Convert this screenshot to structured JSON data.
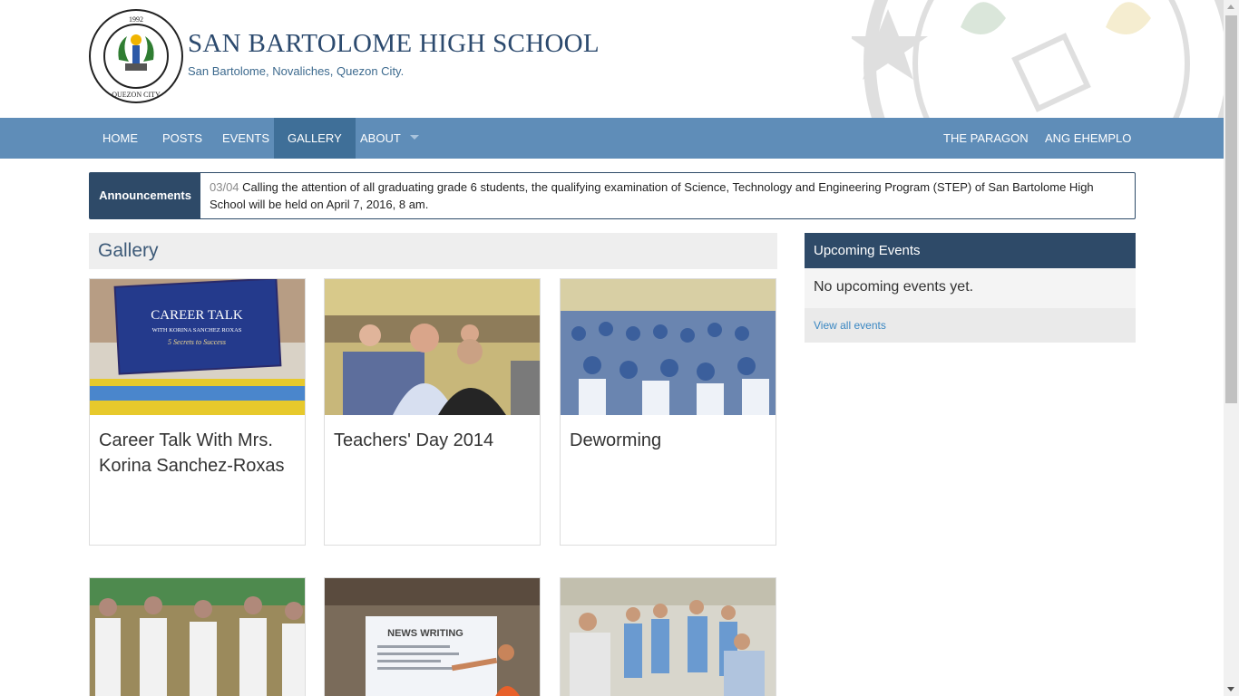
{
  "header": {
    "title": "SAN BARTOLOME HIGH SCHOOL",
    "subtitle": "San Bartolome, Novaliches, Quezon City.",
    "logo_text_top": "SAN BARTOLOME HIGH SCHOOL",
    "logo_text_bottom": "QUEZON CITY",
    "logo_year": "1992"
  },
  "nav": {
    "left": [
      "HOME",
      "POSTS",
      "EVENTS",
      "GALLERY",
      "ABOUT"
    ],
    "right": [
      "THE PARAGON",
      "ANG EHEMPLO"
    ],
    "active": "GALLERY"
  },
  "announcements": {
    "label": "Announcements",
    "date": "03/04",
    "text": "Calling the attention of all graduating grade 6 students, the qualifying examination of Science, Technology and Engineering Program (STEP) of San Bartolome High School will be held on April 7, 2016, 8 am."
  },
  "gallery": {
    "title": "Gallery",
    "albums": [
      {
        "title": "Career Talk With Mrs. Korina Sanchez-Roxas",
        "banner_title": "CAREER TALK",
        "banner_sub": "WITH KORINA SANCHEZ ROXAS",
        "banner_tag": "5 Secrets to Success"
      },
      {
        "title": "Teachers' Day 2014"
      },
      {
        "title": "Deworming"
      },
      {
        "title": ""
      },
      {
        "title": "",
        "slide_title": "NEWS WRITING"
      },
      {
        "title": ""
      }
    ]
  },
  "sidebar": {
    "title": "Upcoming Events",
    "empty": "No upcoming events yet.",
    "link": "View all events"
  },
  "colors": {
    "nav": "#5f8db8",
    "nav_active": "#3f6f98",
    "dark_blue": "#2e4a68",
    "link": "#3a87c2"
  }
}
